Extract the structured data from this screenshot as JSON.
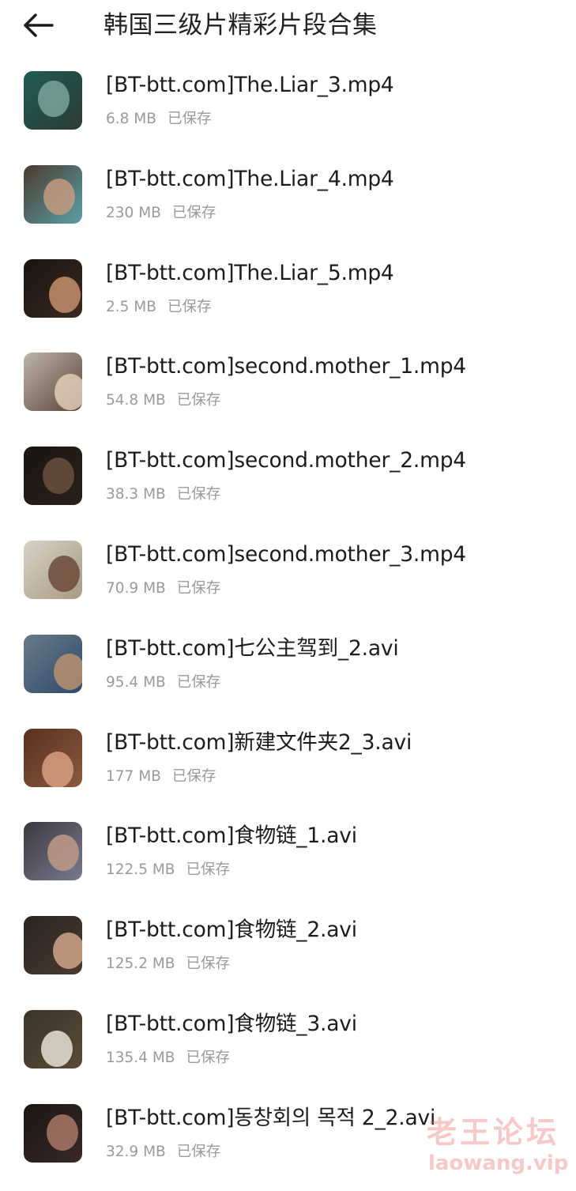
{
  "header": {
    "back_icon": "arrow-left-icon",
    "title": "韩国三级片精彩片段合集"
  },
  "files": [
    {
      "name": "[BT-btt.com]The.Liar_3.mp4",
      "size": "6.8 MB",
      "status": "已保存",
      "thumb_colors": [
        "#1f5c55",
        "#7aa39b",
        "#2d3b34"
      ]
    },
    {
      "name": "[BT-btt.com]The.Liar_4.mp4",
      "size": "230 MB",
      "status": "已保存",
      "thumb_colors": [
        "#4a3a2e",
        "#c49a80",
        "#5aa0a8"
      ]
    },
    {
      "name": "[BT-btt.com]The.Liar_5.mp4",
      "size": "2.5 MB",
      "status": "已保存",
      "thumb_colors": [
        "#1a1410",
        "#c48f6c",
        "#3a2a20"
      ]
    },
    {
      "name": "[BT-btt.com]second.mother_1.mp4",
      "size": "54.8 MB",
      "status": "已保存",
      "thumb_colors": [
        "#bfb5a8",
        "#e2cdb8",
        "#5a4438"
      ]
    },
    {
      "name": "[BT-btt.com]second.mother_2.mp4",
      "size": "38.3 MB",
      "status": "已保存",
      "thumb_colors": [
        "#1a1512",
        "#6b5040",
        "#2a201a"
      ]
    },
    {
      "name": "[BT-btt.com]second.mother_3.mp4",
      "size": "70.9 MB",
      "status": "已保存",
      "thumb_colors": [
        "#d8d2c4",
        "#6a4a38",
        "#a89a84"
      ]
    },
    {
      "name": "[BT-btt.com]七公主驾到_2.avi",
      "size": "95.4 MB",
      "status": "已保存",
      "thumb_colors": [
        "#6a7a8a",
        "#b89070",
        "#2d4a6a"
      ]
    },
    {
      "name": "[BT-btt.com]新建文件夹2_3.avi",
      "size": "177 MB",
      "status": "已保存",
      "thumb_colors": [
        "#5a3020",
        "#d8a080",
        "#8a5a40"
      ]
    },
    {
      "name": "[BT-btt.com]食物链_1.avi",
      "size": "122.5 MB",
      "status": "已保存",
      "thumb_colors": [
        "#3a3a40",
        "#c09a88",
        "#7a7a90"
      ]
    },
    {
      "name": "[BT-btt.com]食物链_2.avi",
      "size": "125.2 MB",
      "status": "已保存",
      "thumb_colors": [
        "#2a2420",
        "#d0a488",
        "#4a3a30"
      ]
    },
    {
      "name": "[BT-btt.com]食物链_3.avi",
      "size": "135.4 MB",
      "status": "已保存",
      "thumb_colors": [
        "#3a3428",
        "#e8e0d4",
        "#5a4a38"
      ]
    },
    {
      "name": "[BT-btt.com]동창회의 목적 2_2.avi",
      "size": "32.9 MB",
      "status": "已保存",
      "thumb_colors": [
        "#1a1414",
        "#a87868",
        "#3a2a28"
      ]
    }
  ],
  "watermark": {
    "cn": "老王论坛",
    "url": "laowang.vip"
  }
}
